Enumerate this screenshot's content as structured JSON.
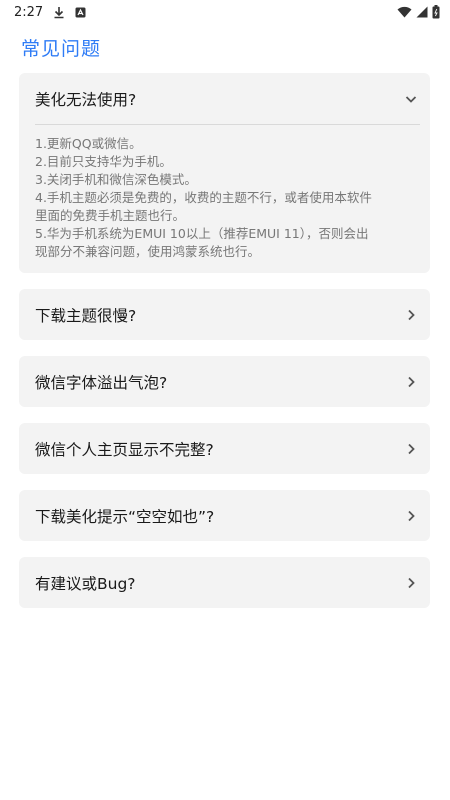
{
  "status_bar": {
    "time": "2:27",
    "icons": [
      "download-icon",
      "notification-icon",
      "wifi-icon",
      "signal-icon",
      "battery-icon"
    ]
  },
  "page": {
    "title": "常见问题"
  },
  "faq": {
    "expanded": {
      "question": "美化无法使用?",
      "answer_lines": [
        "1.更新QQ或微信。",
        "2.目前只支持华为手机。",
        "3.关闭手机和微信深色模式。",
        "4.手机主题必须是免费的，收费的主题不行，或者使用本软件",
        "里面的免费手机主题也行。",
        "5.华为手机系统为EMUI 10以上（推荐EMUI 11），否则会出",
        "现部分不兼容问题，使用鸿蒙系统也行。"
      ]
    },
    "items": [
      {
        "question": "下载主题很慢?"
      },
      {
        "question": "微信字体溢出气泡?"
      },
      {
        "question": "微信个人主页显示不完整?"
      },
      {
        "question": "下载美化提示“空空如也”?"
      },
      {
        "question": "有建议或Bug?"
      }
    ]
  },
  "colors": {
    "accent": "#2f7cf6",
    "card_bg": "#f3f3f3"
  }
}
